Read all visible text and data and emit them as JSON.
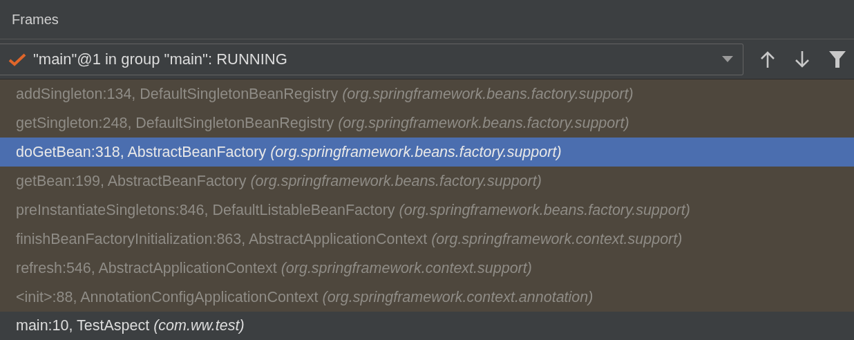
{
  "panel": {
    "title": "Frames"
  },
  "thread_selector": {
    "value": "\"main\"@1 in group \"main\": RUNNING",
    "checked": true
  },
  "frames": [
    {
      "method": "addSingleton:134, DefaultSingletonBeanRegistry",
      "package": "(org.springframework.beans.factory.support)",
      "library": true,
      "selected": false
    },
    {
      "method": "getSingleton:248, DefaultSingletonBeanRegistry",
      "package": "(org.springframework.beans.factory.support)",
      "library": true,
      "selected": false
    },
    {
      "method": "doGetBean:318, AbstractBeanFactory",
      "package": "(org.springframework.beans.factory.support)",
      "library": true,
      "selected": true
    },
    {
      "method": "getBean:199, AbstractBeanFactory",
      "package": "(org.springframework.beans.factory.support)",
      "library": true,
      "selected": false
    },
    {
      "method": "preInstantiateSingletons:846, DefaultListableBeanFactory",
      "package": "(org.springframework.beans.factory.support)",
      "library": true,
      "selected": false
    },
    {
      "method": "finishBeanFactoryInitialization:863, AbstractApplicationContext",
      "package": "(org.springframework.context.support)",
      "library": true,
      "selected": false
    },
    {
      "method": "refresh:546, AbstractApplicationContext",
      "package": "(org.springframework.context.support)",
      "library": true,
      "selected": false
    },
    {
      "method": "<init>:88, AnnotationConfigApplicationContext",
      "package": "(org.springframework.context.annotation)",
      "library": true,
      "selected": false
    },
    {
      "method": "main:10, TestAspect",
      "package": "(com.ww.test)",
      "library": false,
      "selected": false
    }
  ]
}
